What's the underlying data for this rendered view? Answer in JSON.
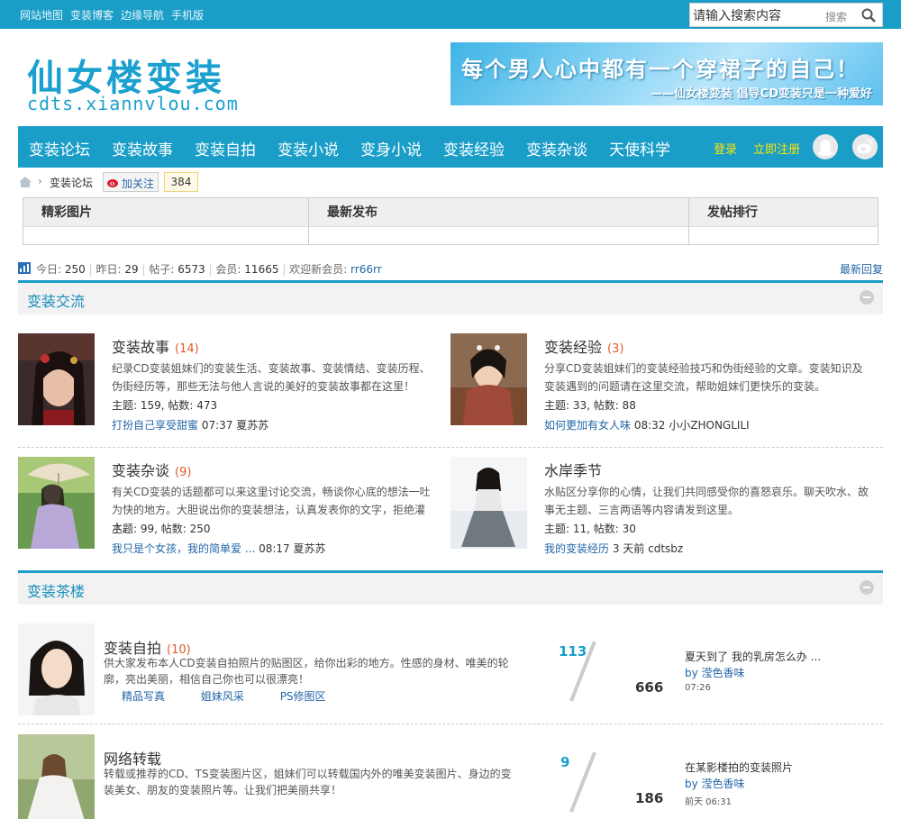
{
  "topbar": {
    "links": [
      "网站地图",
      "变装博客",
      "边缘导航",
      "手机版"
    ],
    "search_placeholder": "请输入搜索内容",
    "search_button": "搜索"
  },
  "header": {
    "logo_cn": "仙女楼变装",
    "logo_en": "cdts.xiannvlou.com",
    "banner_line1": "每个男人心中都有一个穿裙子的自己！",
    "banner_line2": "——仙女楼变装  倡导CD变装只是一种爱好"
  },
  "nav": {
    "items": [
      "变装论坛",
      "变装故事",
      "变装自拍",
      "变装小说",
      "变身小说",
      "变装经验",
      "变装杂谈",
      "天使科学"
    ],
    "login": "登录",
    "register": "立即注册"
  },
  "breadcrumb": {
    "current": "变装论坛",
    "follow_label": "加关注",
    "follow_count": "384"
  },
  "feature_tabs": [
    "精彩图片",
    "最新发布",
    "发帖排行"
  ],
  "stats": {
    "today_label": "今日:",
    "today": "250",
    "yesterday_label": "昨日:",
    "yesterday": "29",
    "posts_label": "帖子:",
    "posts": "6573",
    "members_label": "会员:",
    "members": "11665",
    "newest_label": "欢迎新会员:",
    "newest": "rr66rr",
    "latest_reply": "最新回复"
  },
  "sections": {
    "exchange": "变装交流",
    "teahouse": "变装茶楼"
  },
  "forums": [
    {
      "name": "变装故事",
      "today": "(14)",
      "desc": "纪录CD变装姐妹们的变装生活、变装故事、变装情结、变装历程、伪街经历等，那些无法与他人言说的美好的变装故事都在这里！",
      "meta": "主题: 159, 帖数: 473",
      "last_title": "打扮自己享受甜蜜",
      "last_time": "07:37",
      "last_user": "夏苏苏"
    },
    {
      "name": "变装经验",
      "today": "(3)",
      "desc": "分享CD变装姐妹们的变装经验技巧和伪街经验的文章。变装知识及变装遇到的问题请在这里交流，帮助姐妹们更快乐的变装。",
      "meta": "主题: 33, 帖数: 88",
      "last_title": "如何更加有女人味",
      "last_time": "08:32",
      "last_user": "小小ZHONGLILI"
    },
    {
      "name": "变装杂谈",
      "today": "(9)",
      "desc": "有关CD变装的话题都可以来这里讨论交流，畅谈你心底的想法一吐为快的地方。大胆说出你的变装想法，认真发表你的文字，拒绝灌水。",
      "meta": "主题: 99, 帖数: 250",
      "last_title": "我只是个女孩，我的简单爱 ...",
      "last_time": "08:17",
      "last_user": "夏苏苏"
    },
    {
      "name": "水岸季节",
      "today": "",
      "desc": "水贴区分享你的心情，让我们共同感受你的喜怒哀乐。聊天吹水、故事无主题、三言两语等内容请发到这里。",
      "meta": "主题: 11, 帖数: 30",
      "last_title": "我的变装经历",
      "last_time": "3 天前",
      "last_user": "cdtsbz"
    }
  ],
  "teahouse": [
    {
      "name": "变装自拍",
      "today": "(10)",
      "desc": "供大家发布本人CD变装自拍照片的贴图区，给你出彩的地方。性感的身材、唯美的轮廓，亮出美丽，相信自己你也可以很漂亮！",
      "subs": [
        "精品写真",
        "姐妹风采",
        "PS修图区"
      ],
      "threads": "113",
      "posts": "666",
      "last_title": "夏天到了 我的乳房怎么办 ...",
      "last_by": "by  滢色香味",
      "last_time": "07:26"
    },
    {
      "name": "网络转载",
      "today": "",
      "desc": "转载或推荐的CD、TS变装图片区，姐妹们可以转载国内外的唯美变装图片、身边的变装美女、朋友的变装照片等。让我们把美丽共享！",
      "subs": [],
      "threads": "9",
      "posts": "186",
      "last_title": "在某影楼拍的变装照片",
      "last_by": "by  滢色香味",
      "last_time": "前天 06:31"
    }
  ]
}
